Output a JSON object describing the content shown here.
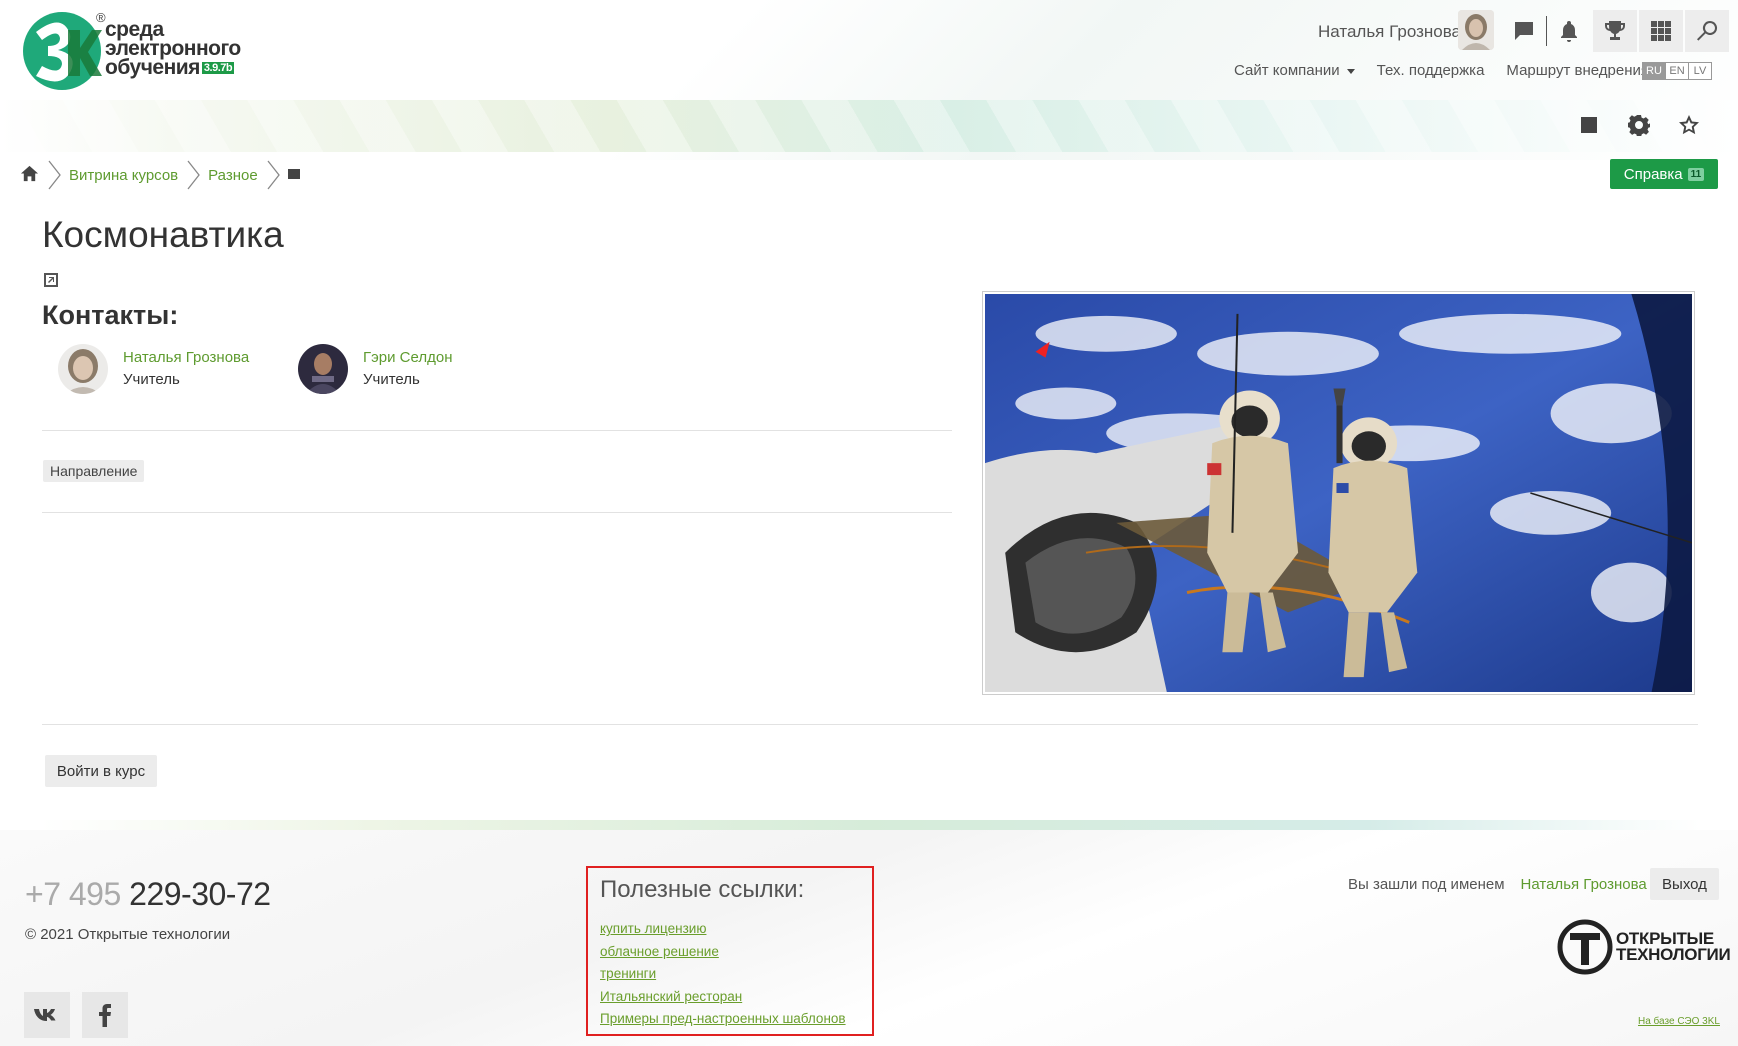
{
  "header": {
    "logo_lines": [
      "среда",
      "электронного",
      "обучения"
    ],
    "logo_version": "3.9.7b",
    "logo_reg": "®",
    "user_name": "Наталья Грознова",
    "nav": {
      "company_site": "Сайт компании",
      "support": "Тех. поддержка",
      "route": "Маршрут внедрения"
    },
    "langs": [
      "RU",
      "EN",
      "LV"
    ],
    "active_lang": "RU"
  },
  "breadcrumb": {
    "items": [
      "Витрина курсов",
      "Разное"
    ]
  },
  "help": {
    "label": "Справка",
    "badge": "11"
  },
  "course": {
    "title": "Космонавтика",
    "contacts_title": "Контакты:",
    "contacts": [
      {
        "name": "Наталья Грознова",
        "role": "Учитель"
      },
      {
        "name": "Гэри Селдон",
        "role": "Учитель"
      }
    ],
    "tag": "Направление",
    "enter_label": "Войти в курс"
  },
  "footer": {
    "phone_prefix": "+7 495",
    "phone_number": "229-30-72",
    "copyright": "© 2021  Открытые технологии",
    "useful_title": "Полезные ссылки:",
    "useful_links": [
      "купить лицензию",
      "облачное решение",
      "тренинги",
      "Итальянский ресторан",
      "Примеры пред-настроенных шаблонов"
    ],
    "logged_as": "Вы зашли под именем",
    "logged_user": "Наталья Грознова",
    "logout": "Выход",
    "ot_logo_lines": [
      "ОТКРЫТЫЕ",
      "ТЕХНОЛОГИИ"
    ],
    "based_on": "На базе СЭО 3KL"
  },
  "colors": {
    "brand_green": "#1d9a47",
    "link_green": "#5e9b2f",
    "highlight_red": "#e02020"
  }
}
